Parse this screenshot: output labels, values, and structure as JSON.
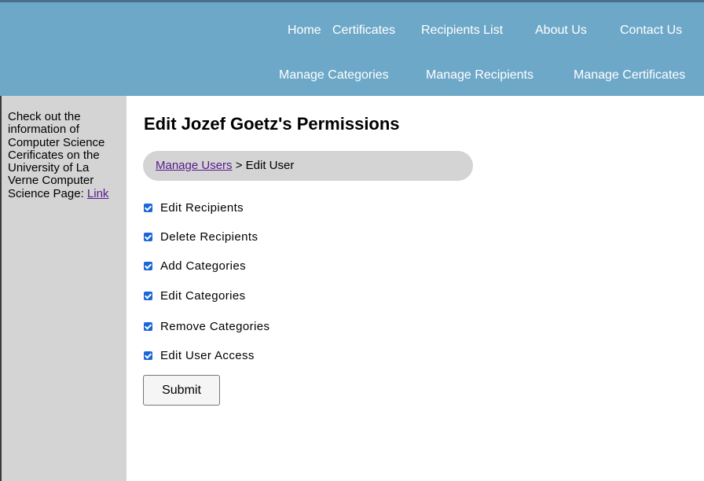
{
  "nav": {
    "primary": [
      {
        "label": "Home"
      },
      {
        "label": "Certificates"
      },
      {
        "label": "Recipients List"
      },
      {
        "label": "About Us"
      },
      {
        "label": "Contact Us"
      }
    ],
    "secondary": [
      {
        "label": "Manage Categories"
      },
      {
        "label": "Manage Recipients"
      },
      {
        "label": "Manage Certificates"
      }
    ]
  },
  "sidebar": {
    "text": "Check out the information of Computer Science Cerificates on the University of La Verne Computer Science Page: ",
    "link_label": "Link"
  },
  "main": {
    "title": "Edit Jozef Goetz's Permissions",
    "breadcrumb": {
      "link_label": "Manage Users",
      "separator": " > ",
      "current": "Edit User"
    },
    "permissions": [
      {
        "label": "Edit Recipients",
        "checked": true
      },
      {
        "label": "Delete Recipients",
        "checked": true
      },
      {
        "label": "Add Categories",
        "checked": true
      },
      {
        "label": "Edit Categories",
        "checked": true
      },
      {
        "label": "Remove Categories",
        "checked": true
      },
      {
        "label": "Edit User Access",
        "checked": true
      }
    ],
    "submit_label": "Submit"
  },
  "colors": {
    "header_bg": "#6ea8c8",
    "sidebar_bg": "#d4d4d4",
    "breadcrumb_bg": "#d4d4d4",
    "checkbox": "#1a66d9",
    "link": "#551a8b"
  }
}
